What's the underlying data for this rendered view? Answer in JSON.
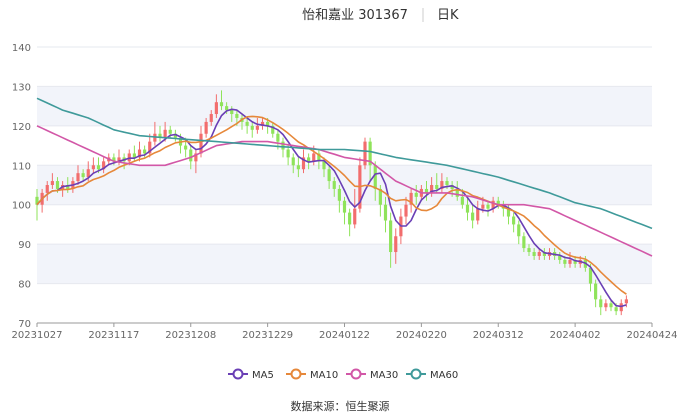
{
  "title": {
    "stock_name": "怡和嘉业 301367",
    "period": "日K"
  },
  "source": "数据来源：恒生聚源",
  "chart_data": {
    "type": "candlestick",
    "ylim": [
      70,
      140
    ],
    "yticks": [
      70,
      80,
      90,
      100,
      110,
      120,
      130,
      140
    ],
    "xtick_labels": [
      "20231027",
      "20231117",
      "20231208",
      "20231229",
      "20240122",
      "20240220",
      "20240312",
      "20240402",
      "20240424"
    ],
    "xtick_index": [
      0,
      15,
      30,
      45,
      60,
      75,
      90,
      105,
      120
    ],
    "num_days": 121,
    "colors": {
      "up": "#f26d6d",
      "down": "#8fe35a",
      "grid_band": "#f2f4fa",
      "axis": "#999999"
    },
    "candles": [
      [
        102,
        100,
        104,
        96
      ],
      [
        100,
        103,
        104,
        98
      ],
      [
        103,
        105,
        106,
        101
      ],
      [
        105,
        106,
        108,
        104
      ],
      [
        106,
        104,
        107,
        103
      ],
      [
        104,
        105,
        106,
        102
      ],
      [
        105,
        104,
        107,
        103
      ],
      [
        104,
        106,
        107,
        103
      ],
      [
        106,
        108,
        110,
        105
      ],
      [
        108,
        107,
        109,
        106
      ],
      [
        107,
        109,
        111,
        106
      ],
      [
        109,
        110,
        112,
        108
      ],
      [
        110,
        109,
        112,
        108
      ],
      [
        109,
        111,
        112,
        108
      ],
      [
        111,
        112,
        113,
        110
      ],
      [
        112,
        111,
        113,
        110
      ],
      [
        111,
        112,
        114,
        110
      ],
      [
        112,
        111,
        113,
        109
      ],
      [
        111,
        113,
        114,
        110
      ],
      [
        113,
        112,
        115,
        111
      ],
      [
        112,
        114,
        116,
        111
      ],
      [
        114,
        113,
        115,
        112
      ],
      [
        113,
        116,
        118,
        112
      ],
      [
        116,
        118,
        121,
        115
      ],
      [
        118,
        117,
        120,
        116
      ],
      [
        117,
        119,
        121,
        116
      ],
      [
        119,
        118,
        120,
        117
      ],
      [
        118,
        117,
        119,
        116
      ],
      [
        117,
        115,
        118,
        113
      ],
      [
        115,
        114,
        117,
        112
      ],
      [
        114,
        111,
        115,
        109
      ],
      [
        111,
        113,
        114,
        108
      ],
      [
        113,
        118,
        120,
        112
      ],
      [
        118,
        121,
        122,
        117
      ],
      [
        121,
        123,
        124,
        120
      ],
      [
        123,
        126,
        128,
        122
      ],
      [
        126,
        125,
        129,
        124
      ],
      [
        125,
        124,
        126,
        123
      ],
      [
        124,
        123,
        125,
        121
      ],
      [
        123,
        122,
        124,
        120
      ],
      [
        122,
        121,
        123,
        119
      ],
      [
        121,
        120,
        122,
        118
      ],
      [
        120,
        119,
        121,
        117
      ],
      [
        119,
        120,
        122,
        118
      ],
      [
        120,
        121,
        122,
        119
      ],
      [
        121,
        120,
        122,
        118
      ],
      [
        120,
        118,
        121,
        117
      ],
      [
        118,
        116,
        119,
        114
      ],
      [
        116,
        114,
        117,
        112
      ],
      [
        114,
        112,
        115,
        110
      ],
      [
        112,
        110,
        113,
        108
      ],
      [
        110,
        109,
        112,
        107
      ],
      [
        109,
        112,
        114,
        108
      ],
      [
        112,
        111,
        113,
        109
      ],
      [
        111,
        113,
        115,
        110
      ],
      [
        113,
        111,
        114,
        109
      ],
      [
        111,
        109,
        112,
        107
      ],
      [
        109,
        106,
        110,
        104
      ],
      [
        106,
        104,
        107,
        102
      ],
      [
        104,
        101,
        105,
        98
      ],
      [
        101,
        98,
        102,
        95
      ],
      [
        98,
        95,
        99,
        92
      ],
      [
        95,
        99,
        104,
        94
      ],
      [
        99,
        110,
        112,
        98
      ],
      [
        110,
        116,
        117,
        109
      ],
      [
        116,
        110,
        117,
        106
      ],
      [
        110,
        104,
        111,
        101
      ],
      [
        104,
        100,
        105,
        97
      ],
      [
        100,
        96,
        102,
        93
      ],
      [
        96,
        88,
        98,
        84
      ],
      [
        88,
        92,
        94,
        85
      ],
      [
        92,
        97,
        99,
        90
      ],
      [
        97,
        100,
        102,
        95
      ],
      [
        100,
        103,
        104,
        98
      ],
      [
        103,
        102,
        105,
        100
      ],
      [
        102,
        104,
        105,
        101
      ],
      [
        104,
        103,
        106,
        101
      ],
      [
        103,
        105,
        107,
        102
      ],
      [
        105,
        104,
        108,
        103
      ],
      [
        104,
        106,
        108,
        103
      ],
      [
        106,
        105,
        107,
        104
      ],
      [
        105,
        104,
        106,
        102
      ],
      [
        104,
        102,
        106,
        101
      ],
      [
        102,
        100,
        104,
        99
      ],
      [
        100,
        98,
        102,
        96
      ],
      [
        98,
        96,
        100,
        94
      ],
      [
        96,
        99,
        101,
        95
      ],
      [
        99,
        100,
        102,
        98
      ],
      [
        100,
        99,
        101,
        97
      ],
      [
        99,
        101,
        102,
        98
      ],
      [
        101,
        100,
        102,
        99
      ],
      [
        100,
        99,
        101,
        97
      ],
      [
        99,
        97,
        100,
        95
      ],
      [
        97,
        95,
        98,
        93
      ],
      [
        95,
        92,
        96,
        90
      ],
      [
        92,
        89,
        93,
        88
      ],
      [
        89,
        88,
        90,
        87
      ],
      [
        88,
        87,
        89,
        86
      ],
      [
        87,
        88,
        89,
        86
      ],
      [
        88,
        87,
        89,
        86
      ],
      [
        87,
        88,
        89,
        86
      ],
      [
        88,
        87,
        89,
        86
      ],
      [
        87,
        86,
        88,
        85
      ],
      [
        86,
        85,
        87,
        84
      ],
      [
        85,
        86,
        88,
        84
      ],
      [
        86,
        85,
        87,
        84
      ],
      [
        85,
        86,
        87,
        84
      ],
      [
        86,
        84,
        87,
        83
      ],
      [
        84,
        80,
        85,
        78
      ],
      [
        80,
        76,
        81,
        74
      ],
      [
        76,
        74,
        77,
        72
      ],
      [
        74,
        75,
        76,
        73
      ],
      [
        75,
        74,
        76,
        73
      ],
      [
        74,
        73,
        75,
        72
      ],
      [
        73,
        75,
        76,
        72
      ],
      [
        75,
        76,
        77,
        74
      ]
    ],
    "ma_series": [
      {
        "name": "MA5",
        "color": "#6a3fb5",
        "window": 5
      },
      {
        "name": "MA10",
        "color": "#e6883a",
        "window": 10
      },
      {
        "name": "MA30",
        "color": "#d257a7",
        "window": 30
      },
      {
        "name": "MA60",
        "color": "#3f9a9a",
        "window": 60
      }
    ],
    "ma30_points": [
      [
        0,
        120
      ],
      [
        5,
        117
      ],
      [
        10,
        114
      ],
      [
        15,
        111
      ],
      [
        20,
        110
      ],
      [
        25,
        110
      ],
      [
        30,
        112
      ],
      [
        35,
        115
      ],
      [
        40,
        116
      ],
      [
        45,
        116
      ],
      [
        50,
        115
      ],
      [
        55,
        114
      ],
      [
        60,
        112
      ],
      [
        65,
        111
      ],
      [
        70,
        106
      ],
      [
        75,
        103
      ],
      [
        80,
        103
      ],
      [
        85,
        102
      ],
      [
        90,
        100
      ],
      [
        95,
        100
      ],
      [
        100,
        99
      ],
      [
        105,
        96
      ],
      [
        110,
        93
      ],
      [
        115,
        90
      ],
      [
        120,
        87
      ]
    ],
    "ma60_points": [
      [
        0,
        127
      ],
      [
        5,
        124
      ],
      [
        10,
        122
      ],
      [
        15,
        119
      ],
      [
        20,
        117.5
      ],
      [
        25,
        117
      ],
      [
        30,
        116.5
      ],
      [
        35,
        116
      ],
      [
        40,
        115.5
      ],
      [
        45,
        115
      ],
      [
        50,
        114.5
      ],
      [
        55,
        114
      ],
      [
        60,
        114
      ],
      [
        65,
        113.5
      ],
      [
        70,
        112
      ],
      [
        75,
        111
      ],
      [
        80,
        110
      ],
      [
        85,
        108.5
      ],
      [
        90,
        107
      ],
      [
        95,
        105
      ],
      [
        100,
        103
      ],
      [
        105,
        100.5
      ],
      [
        110,
        99
      ],
      [
        115,
        96.5
      ],
      [
        120,
        94
      ]
    ]
  }
}
